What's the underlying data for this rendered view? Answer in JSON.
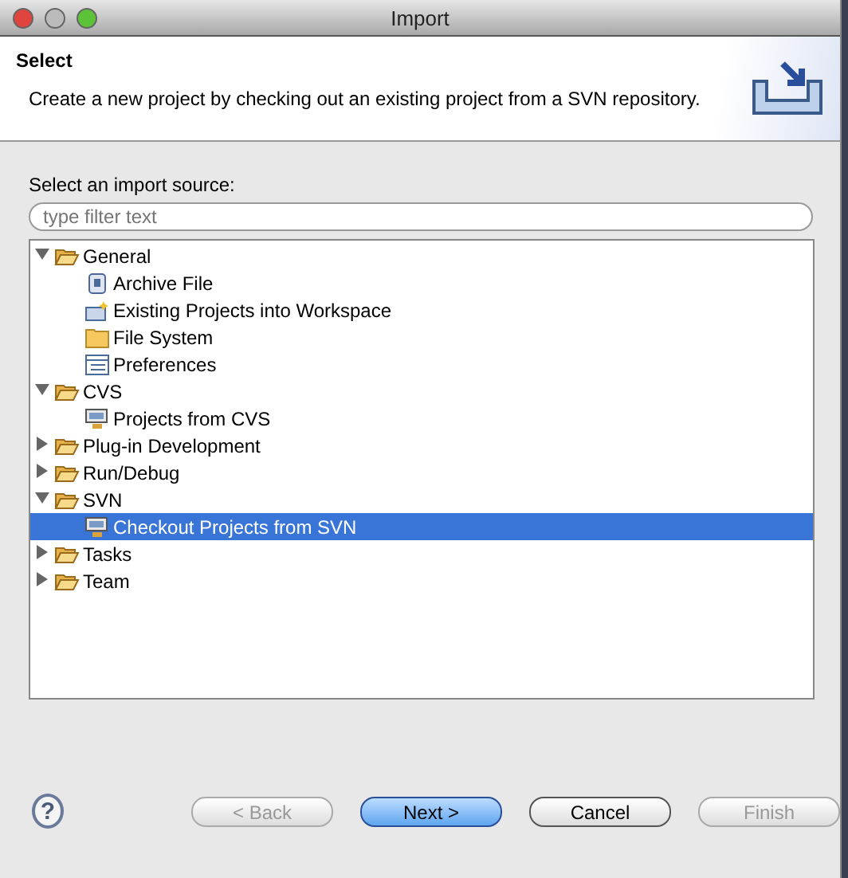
{
  "window": {
    "title": "Import"
  },
  "header": {
    "title": "Select",
    "description": "Create a new project by checking out an existing project from a SVN repository."
  },
  "source_label": "Select an import source:",
  "filter": {
    "placeholder": "type filter text"
  },
  "tree": [
    {
      "label": "General",
      "kind": "folder",
      "expanded": true,
      "selected": false,
      "children": [
        {
          "label": "Archive File",
          "kind": "archive",
          "selected": false
        },
        {
          "label": "Existing Projects into Workspace",
          "kind": "project",
          "selected": false
        },
        {
          "label": "File System",
          "kind": "folder-closed",
          "selected": false
        },
        {
          "label": "Preferences",
          "kind": "prefs",
          "selected": false
        }
      ]
    },
    {
      "label": "CVS",
      "kind": "folder",
      "expanded": true,
      "selected": false,
      "children": [
        {
          "label": "Projects from CVS",
          "kind": "repo",
          "selected": false
        }
      ]
    },
    {
      "label": "Plug-in Development",
      "kind": "folder",
      "expanded": false,
      "selected": false
    },
    {
      "label": "Run/Debug",
      "kind": "folder",
      "expanded": false,
      "selected": false
    },
    {
      "label": "SVN",
      "kind": "folder",
      "expanded": true,
      "selected": false,
      "children": [
        {
          "label": "Checkout Projects from SVN",
          "kind": "repo",
          "selected": true
        }
      ]
    },
    {
      "label": "Tasks",
      "kind": "folder",
      "expanded": false,
      "selected": false
    },
    {
      "label": "Team",
      "kind": "folder",
      "expanded": false,
      "selected": false
    }
  ],
  "help": "?",
  "buttons": [
    {
      "label": "< Back",
      "disabled": true,
      "default": false
    },
    {
      "label": "Next >",
      "disabled": false,
      "default": true
    },
    {
      "label": "Cancel",
      "disabled": false,
      "default": false
    },
    {
      "label": "Finish",
      "disabled": true,
      "default": false
    }
  ]
}
